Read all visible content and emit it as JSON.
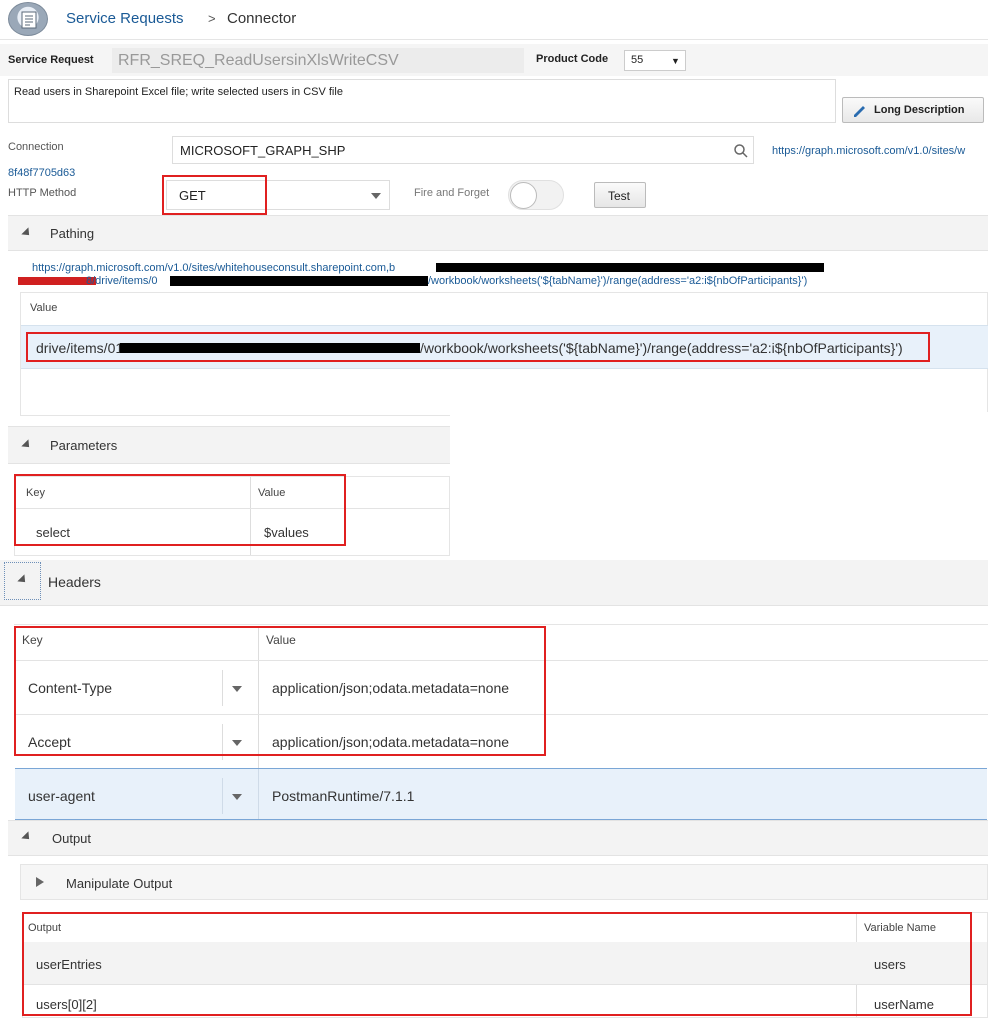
{
  "breadcrumb": {
    "root": "Service Requests",
    "separator": ">",
    "current": "Connector"
  },
  "service_request": {
    "label": "Service Request",
    "value": "RFR_SREQ_ReadUsersinXlsWriteCSV"
  },
  "product_code": {
    "label": "Product Code",
    "value": "55"
  },
  "description": {
    "value": "Read users in Sharepoint Excel file; write selected users in CSV file"
  },
  "long_description_button": "Long Description",
  "connection": {
    "label": "Connection",
    "value": "MICROSOFT_GRAPH_SHP",
    "url_start": "https://graph.microsoft.com/v1.0/sites/w",
    "url_cont": "8f48f7705d63"
  },
  "http_method": {
    "label": "HTTP Method",
    "value": "GET"
  },
  "fire_and_forget": {
    "label": "Fire and Forget",
    "on": false
  },
  "test_button": "Test",
  "pathing": {
    "title": "Pathing",
    "url_line1": "https://graph.microsoft.com/v1.0/sites/whitehouseconsult.sharepoint.com,b",
    "url_line2_a": "8/drive/items/0",
    "url_line2_b": "/workbook/worksheets('${tabName}')/range(address='a2:i${nbOfParticipants}')",
    "value_header": "Value",
    "value_a": "drive/items/01",
    "value_b": "/workbook/worksheets('${tabName}')/range(address='a2:i${nbOfParticipants}')"
  },
  "parameters": {
    "title": "Parameters",
    "headers": [
      "Key",
      "Value"
    ],
    "rows": [
      {
        "key": "select",
        "value": "$values"
      }
    ]
  },
  "headers_section": {
    "title": "Headers",
    "headers": [
      "Key",
      "Value"
    ],
    "rows": [
      {
        "key": "Content-Type",
        "value": "application/json;odata.metadata=none"
      },
      {
        "key": "Accept",
        "value": "application/json;odata.metadata=none"
      },
      {
        "key": "user-agent",
        "value": "PostmanRuntime/7.1.1"
      }
    ]
  },
  "output": {
    "title": "Output",
    "manipulate": "Manipulate Output",
    "headers": [
      "Output",
      "Variable Name"
    ],
    "rows": [
      {
        "output": "userEntries",
        "variable": "users"
      },
      {
        "output": "users[0][2]",
        "variable": "userName"
      }
    ]
  },
  "colors": {
    "link": "#1a5a96",
    "highlight": "#e02020",
    "selected_row": "#e8f1fa"
  }
}
